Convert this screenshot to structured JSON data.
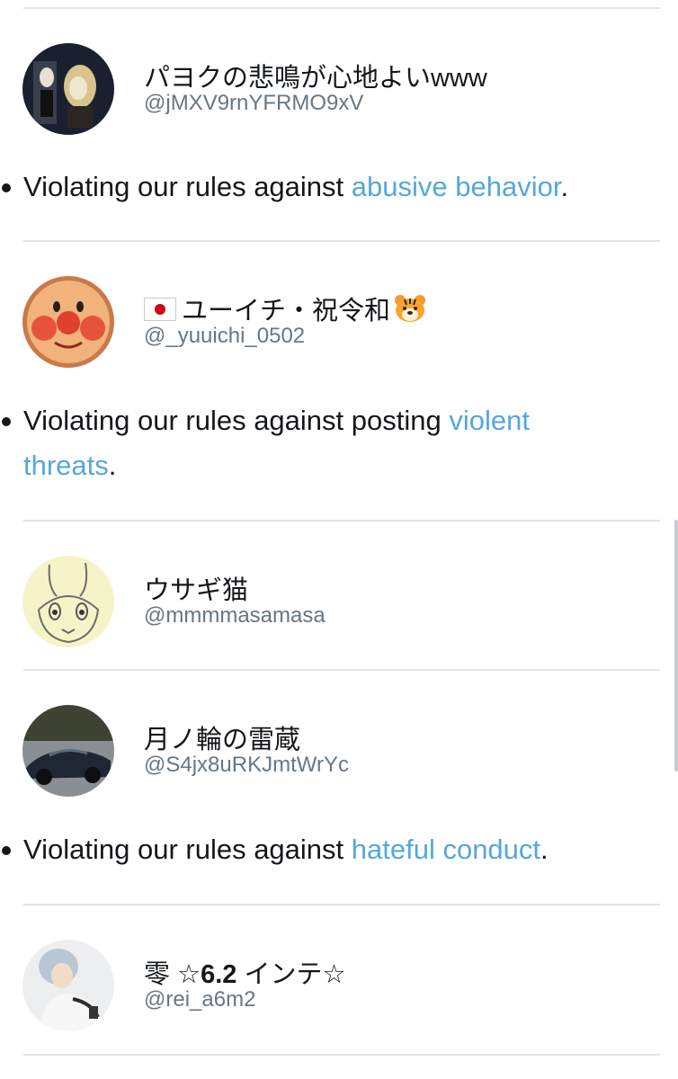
{
  "accounts": [
    {
      "name": "パヨクの悲鳴が心地よいwww",
      "handle": "@jMXV9rnYFRMO9xV"
    },
    {
      "name": "ユーイチ・祝令和",
      "handle": "@_yuuichi_0502"
    },
    {
      "name": "ウサギ猫",
      "handle": "@mmmmasamasa"
    },
    {
      "name": "月ノ輪の雷蔵",
      "handle": "@S4jx8uRKJmtWrYc"
    },
    {
      "name_prefix": "零 ☆",
      "name_bold": "6.2",
      "name_suffix": " インテ☆",
      "handle": "@rei_a6m2"
    }
  ],
  "reasons": [
    {
      "prefix": "Violating our rules against ",
      "link": "abusive behavior",
      "suffix": "."
    },
    {
      "prefix": "Violating our rules against posting ",
      "link": "violent threats",
      "suffix": "."
    },
    {
      "prefix": "Violating our rules against ",
      "link": "hateful conduct",
      "suffix": "."
    }
  ],
  "icons": {
    "flag": "japan-flag-emoji",
    "tiger": "tiger-face-emoji"
  },
  "colors": {
    "link": "#55a7dc",
    "handle": "#657786",
    "text": "#14171a",
    "divider": "#e3e5e8"
  }
}
